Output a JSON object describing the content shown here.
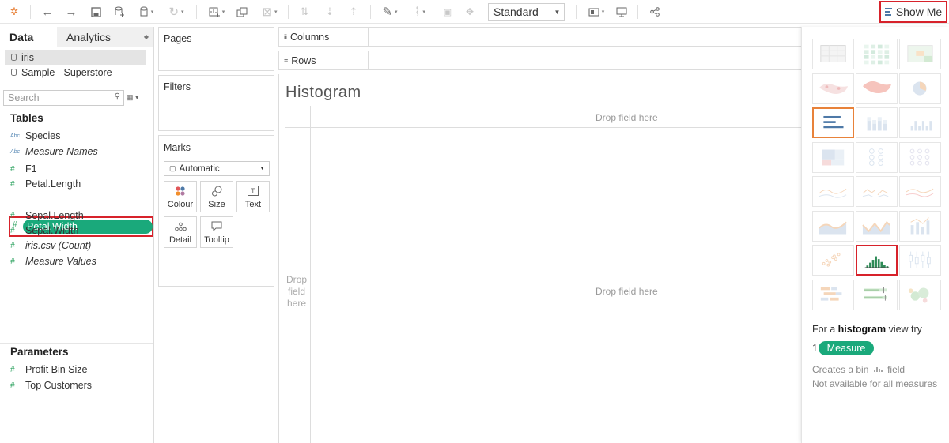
{
  "toolbar": {
    "view_mode": "Standard",
    "show_me_label": "Show Me",
    "icons": [
      "tableau-logo-icon",
      "undo-icon",
      "redo-icon",
      "save-icon",
      "new-datasource-icon",
      "pause-updates-icon",
      "refresh-icon",
      "new-worksheet-icon",
      "duplicate-icon",
      "clear-icon",
      "swap-icon",
      "sort-asc-icon",
      "sort-desc-icon",
      "highlight-icon",
      "group-icon",
      "labels-icon",
      "fix-axes-icon",
      "fit-icon",
      "presentation-icon",
      "share-icon"
    ]
  },
  "data_pane": {
    "tab_data": "Data",
    "tab_analytics": "Analytics",
    "datasources": [
      "iris",
      "Sample - Superstore"
    ],
    "search_placeholder": "Search",
    "tables_title": "Tables",
    "dimensions": [
      {
        "label": "Species",
        "type": "Abc"
      },
      {
        "label": "Measure Names",
        "type": "Abc"
      }
    ],
    "measures": [
      {
        "label": "F1",
        "type": "#"
      },
      {
        "label": "Petal.Length",
        "type": "#"
      },
      {
        "label": "Petal.Width",
        "type": "#"
      },
      {
        "label": "Sepal.Length",
        "type": "#"
      },
      {
        "label": "Sepal.Width",
        "type": "#"
      },
      {
        "label": "iris.csv (Count)",
        "type": "#"
      },
      {
        "label": "Measure Values",
        "type": "#"
      }
    ],
    "parameters_title": "Parameters",
    "parameters": [
      {
        "label": "Profit Bin Size",
        "type": "#"
      },
      {
        "label": "Top Customers",
        "type": "#"
      }
    ]
  },
  "cards": {
    "pages": "Pages",
    "filters": "Filters",
    "marks": "Marks",
    "mark_type": "Automatic",
    "mark_buttons": [
      "Colour",
      "Size",
      "Text",
      "Detail",
      "Tooltip"
    ]
  },
  "shelves": {
    "columns": "Columns",
    "rows": "Rows"
  },
  "view": {
    "title": "Histogram",
    "drop_columns": "Drop field here",
    "drop_rows": "Drop field here",
    "drop_center": "Drop field here"
  },
  "show_me": {
    "hint_prefix": "For a ",
    "hint_chart": "histogram",
    "hint_suffix": " view try",
    "requirement_count": "1",
    "requirement_pill": "Measure",
    "note_1": "Creates a bin",
    "note_1_suffix": "field",
    "note_2": "Not available for all measures",
    "selected_chart": "horizontal-bars",
    "highlighted_chart": "histogram"
  },
  "colors": {
    "pill_green": "#1aa97b",
    "highlight_red": "#d7222b",
    "selection_orange": "#e8823a",
    "tableau_blue": "#4e79a7"
  }
}
